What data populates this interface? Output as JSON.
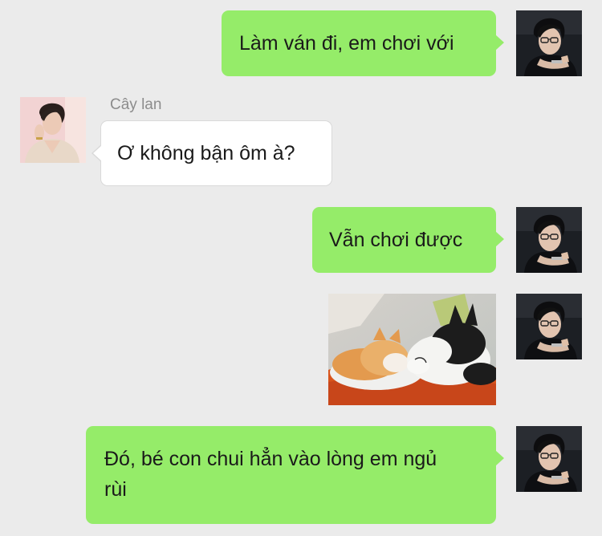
{
  "conversation": {
    "messages": [
      {
        "sender": "me",
        "type": "text",
        "text": "Làm ván đi, em chơi với",
        "avatar_icon": "man-glasses-portrait-icon"
      },
      {
        "sender": "Cây lan",
        "type": "text",
        "sender_name": "Cây lan",
        "text": "Ơ không bận ôm à?",
        "avatar_icon": "man-pink-background-portrait-icon"
      },
      {
        "sender": "me",
        "type": "text",
        "text": "Vẫn chơi được",
        "avatar_icon": "man-glasses-portrait-icon"
      },
      {
        "sender": "me",
        "type": "image",
        "image_icon": "cats-hugging-photo",
        "avatar_icon": "man-glasses-portrait-icon"
      },
      {
        "sender": "me",
        "type": "text",
        "text_line1": "Đó, bé con chui hẳn vào lòng em ngủ",
        "text_line2": "rùi",
        "avatar_icon": "man-glasses-portrait-icon"
      }
    ]
  },
  "colors": {
    "background": "#ebebeb",
    "my_bubble": "#95ec69",
    "their_bubble": "#ffffff",
    "sender_name": "#8c8c8c"
  }
}
